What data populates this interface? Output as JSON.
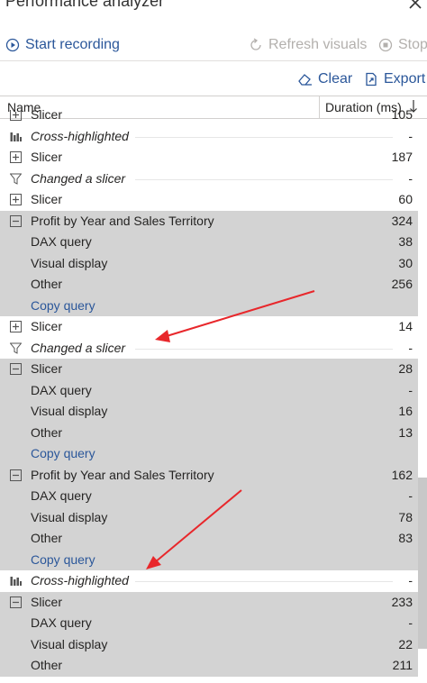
{
  "window": {
    "title": "Performance analyzer"
  },
  "toolbar": {
    "start_recording": "Start recording",
    "refresh_visuals": "Refresh visuals",
    "stop": "Stop",
    "clear": "Clear",
    "export": "Export"
  },
  "table": {
    "headers": {
      "name": "Name",
      "duration": "Duration (ms)"
    },
    "rows": [
      {
        "label": "Slicer",
        "value": "105",
        "icon": "expand",
        "gray": false
      },
      {
        "label": "Cross-highlighted",
        "value": "-",
        "icon": "bar-chart",
        "italic": true,
        "gray": false
      },
      {
        "label": "Slicer",
        "value": "187",
        "icon": "expand",
        "gray": false
      },
      {
        "label": "Changed a slicer",
        "value": "-",
        "icon": "funnel",
        "italic": true,
        "gray": false
      },
      {
        "label": "Slicer",
        "value": "60",
        "icon": "expand",
        "gray": false
      },
      {
        "label": "Profit by Year and Sales Territory",
        "value": "324",
        "icon": "collapse",
        "gray": true
      },
      {
        "label": "DAX query",
        "value": "38",
        "icon": "none",
        "gray": true
      },
      {
        "label": "Visual display",
        "value": "30",
        "icon": "none",
        "gray": true
      },
      {
        "label": "Other",
        "value": "256",
        "icon": "none",
        "gray": true
      },
      {
        "label": "Copy query",
        "value": "",
        "icon": "none",
        "link": true,
        "gray": true
      },
      {
        "label": "Slicer",
        "value": "14",
        "icon": "expand",
        "gray": false
      },
      {
        "label": "Changed a slicer",
        "value": "-",
        "icon": "funnel",
        "italic": true,
        "gray": false
      },
      {
        "label": "Slicer",
        "value": "28",
        "icon": "collapse",
        "gray": true
      },
      {
        "label": "DAX query",
        "value": "-",
        "icon": "none",
        "gray": true
      },
      {
        "label": "Visual display",
        "value": "16",
        "icon": "none",
        "gray": true
      },
      {
        "label": "Other",
        "value": "13",
        "icon": "none",
        "gray": true
      },
      {
        "label": "Copy query",
        "value": "",
        "icon": "none",
        "link": true,
        "gray": true
      },
      {
        "label": "Profit by Year and Sales Territory",
        "value": "162",
        "icon": "collapse",
        "gray": true
      },
      {
        "label": "DAX query",
        "value": "-",
        "icon": "none",
        "gray": true
      },
      {
        "label": "Visual display",
        "value": "78",
        "icon": "none",
        "gray": true
      },
      {
        "label": "Other",
        "value": "83",
        "icon": "none",
        "gray": true
      },
      {
        "label": "Copy query",
        "value": "",
        "icon": "none",
        "link": true,
        "gray": true
      },
      {
        "label": "Cross-highlighted",
        "value": "-",
        "icon": "bar-chart",
        "italic": true,
        "gray": false
      },
      {
        "label": "Slicer",
        "value": "233",
        "icon": "collapse",
        "gray": true
      },
      {
        "label": "DAX query",
        "value": "-",
        "icon": "none",
        "gray": true
      },
      {
        "label": "Visual display",
        "value": "22",
        "icon": "none",
        "gray": true
      },
      {
        "label": "Other",
        "value": "211",
        "icon": "none",
        "gray": true
      }
    ]
  },
  "colors": {
    "link": "#2b579a",
    "arrow": "#e8272b",
    "row_highlight": "#d3d3d3"
  }
}
